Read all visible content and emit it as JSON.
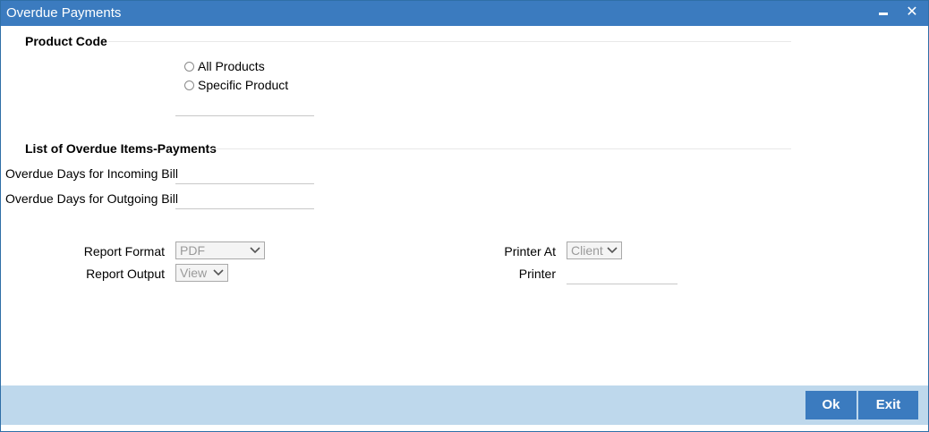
{
  "window": {
    "title": "Overdue Payments",
    "minimize_icon": "minimize-icon",
    "close_icon": "close-icon",
    "close_glyph": "✕"
  },
  "product_code": {
    "section_title": "Product Code",
    "options": [
      {
        "label": "All Products",
        "selected": false
      },
      {
        "label": "Specific Product",
        "selected": false
      }
    ],
    "product_value": ""
  },
  "overdue_items": {
    "section_title": "List of Overdue Items-Payments",
    "incoming_label": "Overdue Days for Incoming Bill",
    "incoming_value": "",
    "outgoing_label": "Overdue Days for Outgoing Bill",
    "outgoing_value": ""
  },
  "report": {
    "format_label": "Report Format",
    "format_value": "PDF",
    "output_label": "Report Output",
    "output_value": "View",
    "printer_at_label": "Printer At",
    "printer_at_value": "Client",
    "printer_label": "Printer",
    "printer_value": ""
  },
  "footer": {
    "ok_label": "Ok",
    "exit_label": "Exit"
  },
  "colors": {
    "titlebar": "#3b7bbf",
    "footer": "#bed8ec",
    "button": "#3b7bbf"
  }
}
